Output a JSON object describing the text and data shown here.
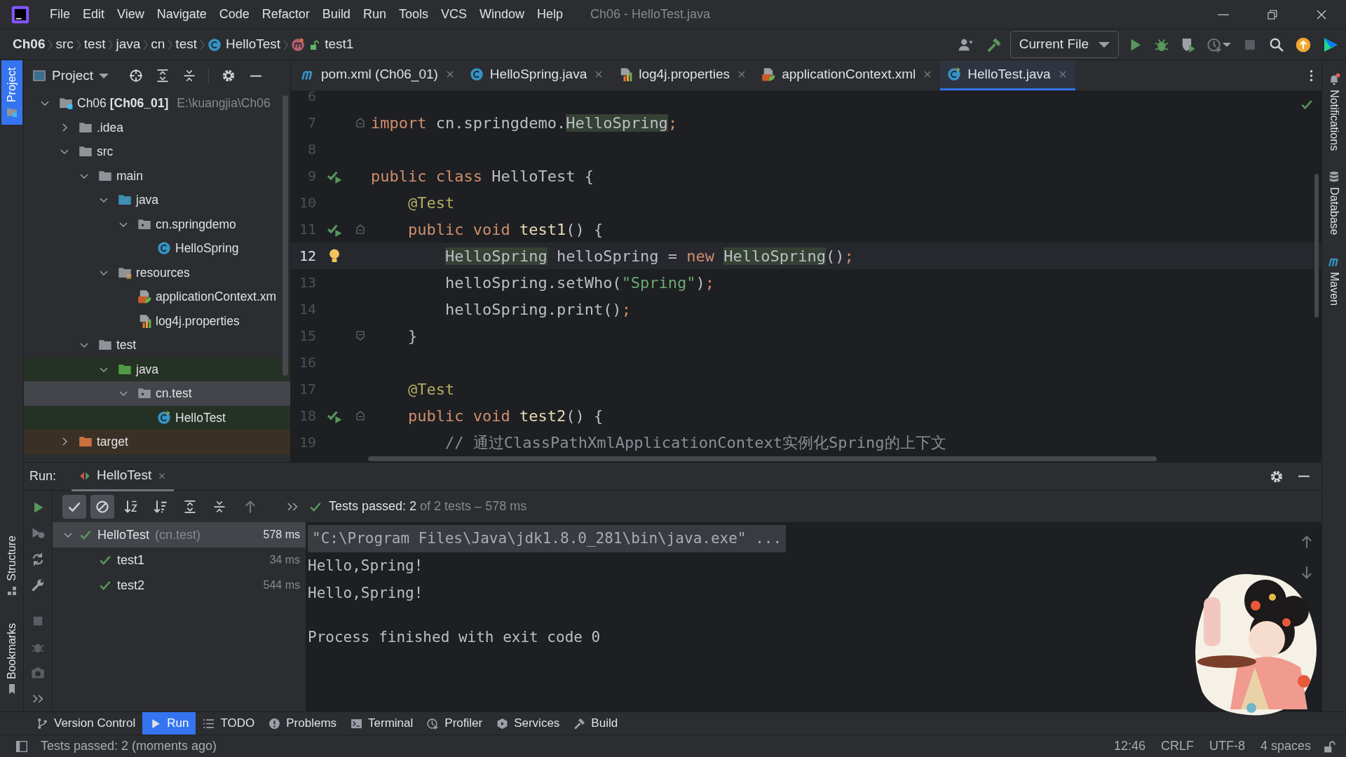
{
  "window": {
    "title": "Ch06 - HelloTest.java"
  },
  "menu": [
    "File",
    "Edit",
    "View",
    "Navigate",
    "Code",
    "Refactor",
    "Build",
    "Run",
    "Tools",
    "VCS",
    "Window",
    "Help"
  ],
  "breadcrumbs": [
    {
      "label": "Ch06",
      "kind": "project"
    },
    {
      "label": "src",
      "kind": "folder"
    },
    {
      "label": "test",
      "kind": "folder"
    },
    {
      "label": "java",
      "kind": "folder"
    },
    {
      "label": "cn",
      "kind": "folder"
    },
    {
      "label": "test",
      "kind": "folder"
    },
    {
      "label": "HelloTest",
      "kind": "class"
    },
    {
      "label": "test1",
      "kind": "method"
    }
  ],
  "run_config": {
    "label": "Current File"
  },
  "tool_stripe_left": [
    {
      "label": "Project",
      "kind": "project",
      "selected": true
    },
    {
      "label": "Structure",
      "kind": "structure",
      "selected": false
    },
    {
      "label": "Bookmarks",
      "kind": "bookmarks",
      "selected": false
    }
  ],
  "tool_stripe_right": [
    {
      "label": "Notifications",
      "kind": "notifications"
    },
    {
      "label": "Database",
      "kind": "database"
    },
    {
      "label": "Maven",
      "kind": "maven"
    }
  ],
  "project_panel": {
    "title": "Project",
    "tree": [
      {
        "label": "Ch06 **[Ch06_01]**",
        "path": "E:\\kuangjia\\Ch06",
        "kind": "module",
        "expanded": true,
        "selected": false,
        "children": [
          {
            "label": ".idea",
            "kind": "folder",
            "expanded": false,
            "selected": false
          },
          {
            "label": "src",
            "kind": "folder",
            "expanded": true,
            "selected": false,
            "children": [
              {
                "label": "main",
                "kind": "folder",
                "expanded": true,
                "selected": false,
                "children": [
                  {
                    "label": "java",
                    "kind": "source",
                    "expanded": true,
                    "selected": false,
                    "children": [
                      {
                        "label": "cn.springdemo",
                        "kind": "package",
                        "expanded": true,
                        "selected": false,
                        "children": [
                          {
                            "label": "HelloSpring",
                            "kind": "class",
                            "selected": false
                          }
                        ]
                      }
                    ]
                  },
                  {
                    "label": "resources",
                    "kind": "resources",
                    "expanded": true,
                    "selected": false,
                    "children": [
                      {
                        "label": "applicationContext.xm",
                        "kind": "xml",
                        "selected": false
                      },
                      {
                        "label": "log4j.properties",
                        "kind": "properties",
                        "selected": false
                      }
                    ]
                  }
                ]
              },
              {
                "label": "test",
                "kind": "folder",
                "expanded": true,
                "selected": false,
                "children": [
                  {
                    "label": "java",
                    "kind": "test-source",
                    "test_scope": true,
                    "expanded": true,
                    "selected": false,
                    "children": [
                      {
                        "label": "cn.test",
                        "kind": "package",
                        "test_scope": true,
                        "expanded": true,
                        "selected": true,
                        "children": [
                          {
                            "label": "HelloTest",
                            "kind": "test-class",
                            "test_scope": true,
                            "selected": false
                          }
                        ]
                      }
                    ]
                  }
                ]
              }
            ]
          },
          {
            "label": "target",
            "kind": "excluded",
            "excluded": true,
            "expanded": false,
            "selected": false
          }
        ]
      }
    ]
  },
  "editor_tabs": [
    {
      "label": "pom.xml (Ch06_01)",
      "kind": "maven",
      "selected": false
    },
    {
      "label": "HelloSpring.java",
      "kind": "class",
      "selected": false
    },
    {
      "label": "log4j.properties",
      "kind": "properties",
      "selected": false
    },
    {
      "label": "applicationContext.xml",
      "kind": "xml",
      "selected": false
    },
    {
      "label": "HelloTest.java",
      "kind": "test-class",
      "selected": true
    }
  ],
  "editor_lines": [
    {
      "number": "6",
      "current": false
    },
    {
      "number": "7",
      "current": false,
      "fold_start": true,
      "tokens": [
        {
          "text": "import",
          "kind": "keyword"
        },
        {
          "text": " cn.springdemo.",
          "kind": "plain"
        },
        {
          "text": "HelloSpring",
          "kind": "usage"
        },
        {
          "text": ";",
          "kind": "punct"
        }
      ]
    },
    {
      "number": "8",
      "current": false
    },
    {
      "number": "9",
      "current": false,
      "run_marker": true,
      "tokens": [
        {
          "text": "public class",
          "kind": "keyword"
        },
        {
          "text": " HelloTest {",
          "kind": "plain"
        }
      ]
    },
    {
      "number": "10",
      "current": false,
      "tokens": [
        {
          "text": "    @Test",
          "kind": "annotation"
        }
      ]
    },
    {
      "number": "11",
      "current": false,
      "run_marker": true,
      "fold_start": true,
      "tokens": [
        {
          "text": "    public void",
          "kind": "keyword"
        },
        {
          "text": " test1",
          "kind": "declaration"
        },
        {
          "text": "() {",
          "kind": "plain"
        }
      ]
    },
    {
      "number": "12",
      "current": true,
      "bulb": true,
      "tokens": [
        {
          "text": "        HelloSpring",
          "kind": "usage"
        },
        {
          "text": " helloSpring = ",
          "kind": "plain"
        },
        {
          "text": "new",
          "kind": "keyword"
        },
        {
          "text": " HelloSpring",
          "kind": "usage"
        },
        {
          "text": "()",
          "kind": "plain"
        },
        {
          "text": ";",
          "kind": "punct"
        }
      ]
    },
    {
      "number": "13",
      "current": false,
      "tokens": [
        {
          "text": "        helloSpring.setWho(",
          "kind": "plain"
        },
        {
          "text": "\"Spring\"",
          "kind": "string"
        },
        {
          "text": ")",
          "kind": "plain"
        },
        {
          "text": ";",
          "kind": "punct"
        }
      ]
    },
    {
      "number": "14",
      "current": false,
      "tokens": [
        {
          "text": "        helloSpring.print()",
          "kind": "plain"
        },
        {
          "text": ";",
          "kind": "punct"
        }
      ]
    },
    {
      "number": "15",
      "current": false,
      "fold_end": true,
      "tokens": [
        {
          "text": "    }",
          "kind": "plain"
        }
      ]
    },
    {
      "number": "16",
      "current": false
    },
    {
      "number": "17",
      "current": false,
      "tokens": [
        {
          "text": "    @Test",
          "kind": "annotation"
        }
      ]
    },
    {
      "number": "18",
      "current": false,
      "run_marker": true,
      "fold_start": true,
      "tokens": [
        {
          "text": "    public void",
          "kind": "keyword"
        },
        {
          "text": " test2",
          "kind": "declaration"
        },
        {
          "text": "() {",
          "kind": "plain"
        }
      ]
    },
    {
      "number": "19",
      "current": false,
      "tokens": [
        {
          "text": "        // 通过ClassPathXmlApplicationContext实例化Spring的上下文",
          "kind": "comment"
        }
      ]
    }
  ],
  "run_panel": {
    "label": "Run:",
    "tab": "HelloTest",
    "toggles": [
      {
        "kind": "show-passed",
        "on": true
      },
      {
        "kind": "show-ignored",
        "on": true
      }
    ],
    "status": {
      "summary": "Tests passed: 2",
      "detail": "of 2 tests – 578 ms"
    },
    "tests": [
      {
        "name": "HelloTest",
        "package": "(cn.test)",
        "duration": "578 ms",
        "passed": true,
        "selected": true,
        "expanded": true,
        "children": [
          {
            "name": "test1",
            "duration": "34 ms",
            "passed": true,
            "selected": false
          },
          {
            "name": "test2",
            "duration": "544 ms",
            "passed": true,
            "selected": false
          }
        ]
      }
    ],
    "console": [
      {
        "text": "\"C:\\Program Files\\Java\\jdk1.8.0_281\\bin\\java.exe\" ...",
        "kind": "command"
      },
      {
        "text": "Hello,Spring!",
        "kind": "output"
      },
      {
        "text": "Hello,Spring!",
        "kind": "output"
      },
      {
        "text": "Process finished with exit code 0",
        "kind": "exit"
      }
    ]
  },
  "bottom_tools": [
    {
      "label": "Version Control",
      "kind": "vcs",
      "selected": false
    },
    {
      "label": "Run",
      "kind": "run",
      "selected": true
    },
    {
      "label": "TODO",
      "kind": "todo",
      "selected": false
    },
    {
      "label": "Problems",
      "kind": "problems",
      "selected": false
    },
    {
      "label": "Terminal",
      "kind": "terminal",
      "selected": false
    },
    {
      "label": "Profiler",
      "kind": "profiler",
      "selected": false
    },
    {
      "label": "Services",
      "kind": "services",
      "selected": false
    },
    {
      "label": "Build",
      "kind": "build",
      "selected": false
    }
  ],
  "status_bar": {
    "message": "Tests passed: 2 (moments ago)",
    "items": [
      "12:46",
      "CRLF",
      "UTF-8",
      "4 spaces"
    ]
  }
}
